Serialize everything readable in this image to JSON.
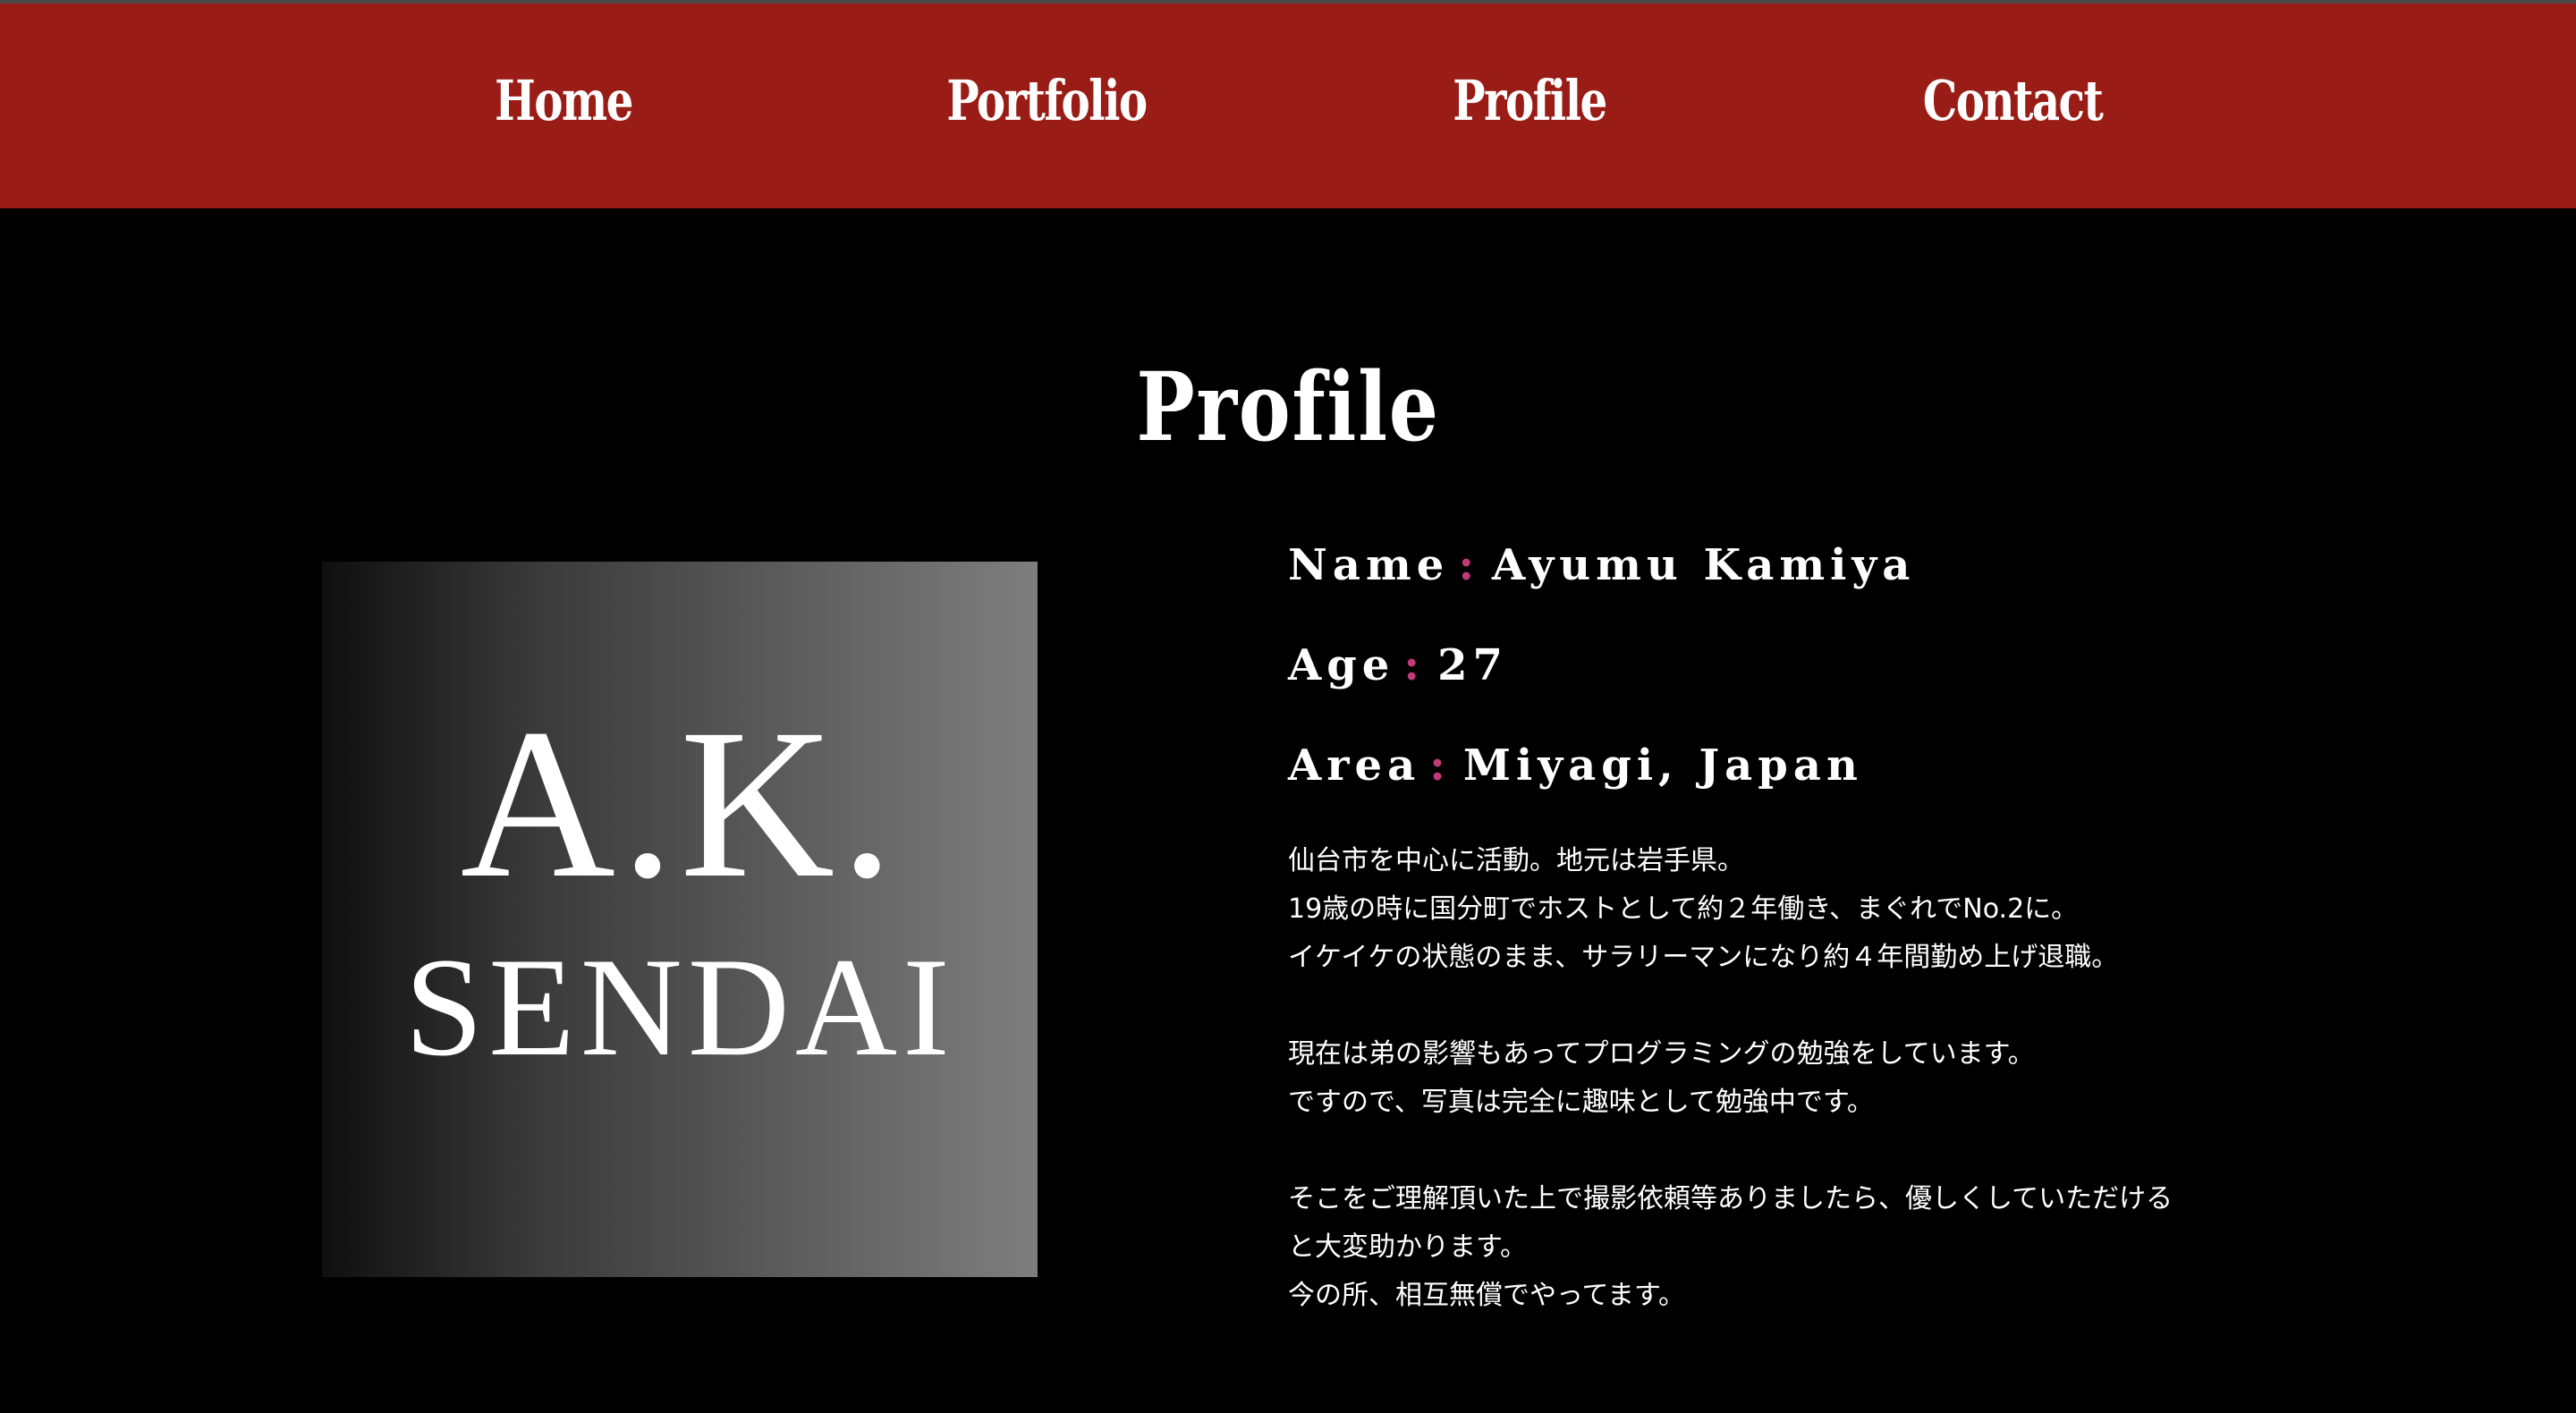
{
  "nav": {
    "items": [
      {
        "label": "Home"
      },
      {
        "label": "Portfolio"
      },
      {
        "label": "Profile"
      },
      {
        "label": "Contact"
      }
    ]
  },
  "page": {
    "title": "Profile"
  },
  "logo": {
    "line1": "A.K.",
    "line2": "SENDAI"
  },
  "profile": {
    "name_label": "Name",
    "name_value": "Ayumu Kamiya",
    "age_label": "Age",
    "age_value": "27",
    "area_label": "Area",
    "area_value": "Miyagi, Japan",
    "separator": ":"
  },
  "bio": {
    "lines": [
      "仙台市を中心に活動。地元は岩手県。",
      "19歳の時に国分町でホストとして約２年働き、まぐれでNo.2に。",
      "イケイケの状態のまま、サラリーマンになり約４年間勤め上げ退職。",
      "",
      "現在は弟の影響もあってプログラミングの勉強をしています。",
      "ですので、写真は完全に趣味として勉強中です。",
      "",
      "そこをご理解頂いた上で撮影依頼等ありましたら、優しくしていただける",
      "と大変助かります。",
      "今の所、相互無償でやってます。"
    ]
  },
  "colors": {
    "nav_background": "#991d16",
    "page_background": "#000000",
    "accent_colon": "#c23a7a",
    "text": "#ffffff"
  }
}
